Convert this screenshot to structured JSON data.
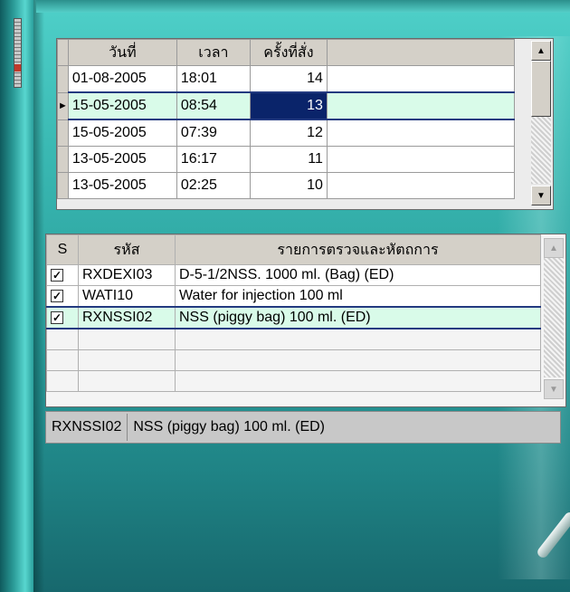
{
  "schedule_grid": {
    "columns": [
      "วันที่",
      "เวลา",
      "ครั้งที่สั่ง",
      ""
    ],
    "rows": [
      {
        "date": "01-08-2005",
        "time": "18:01",
        "count": "14"
      },
      {
        "date": "15-05-2005",
        "time": "08:54",
        "count": "13"
      },
      {
        "date": "15-05-2005",
        "time": "07:39",
        "count": "12"
      },
      {
        "date": "13-05-2005",
        "time": "16:17",
        "count": "11"
      },
      {
        "date": "13-05-2005",
        "time": "02:25",
        "count": "10"
      }
    ],
    "selected_row": 1,
    "current_row_marker": "►"
  },
  "orders_grid": {
    "columns": [
      "S",
      "รหัส",
      "รายการตรวจและหัตถการ"
    ],
    "rows": [
      {
        "checked": "✓",
        "code": "RXDEXI03",
        "description": "D-5-1/2NSS.  1000 ml. (Bag) (ED)"
      },
      {
        "checked": "✓",
        "code": "WATI10",
        "description": "Water for injection 100 ml"
      },
      {
        "checked": "✓",
        "code": "RXNSSI02",
        "description": "NSS (piggy bag) 100 ml.  (ED)"
      }
    ],
    "selected_row": 2
  },
  "status": {
    "code": "RXNSSI02",
    "description": "NSS (piggy bag) 100 ml.  (ED)"
  },
  "colors": {
    "background_teal": "#3ab9b3",
    "selection_navy": "#0a246a",
    "selected_row_bg": "#d9fbe9"
  },
  "icons": {
    "scroll_up": "scroll-up-arrow-icon",
    "scroll_down": "scroll-down-arrow-icon",
    "row_pointer": "row-pointer-icon",
    "checkbox": "checkbox-checked-icon"
  }
}
